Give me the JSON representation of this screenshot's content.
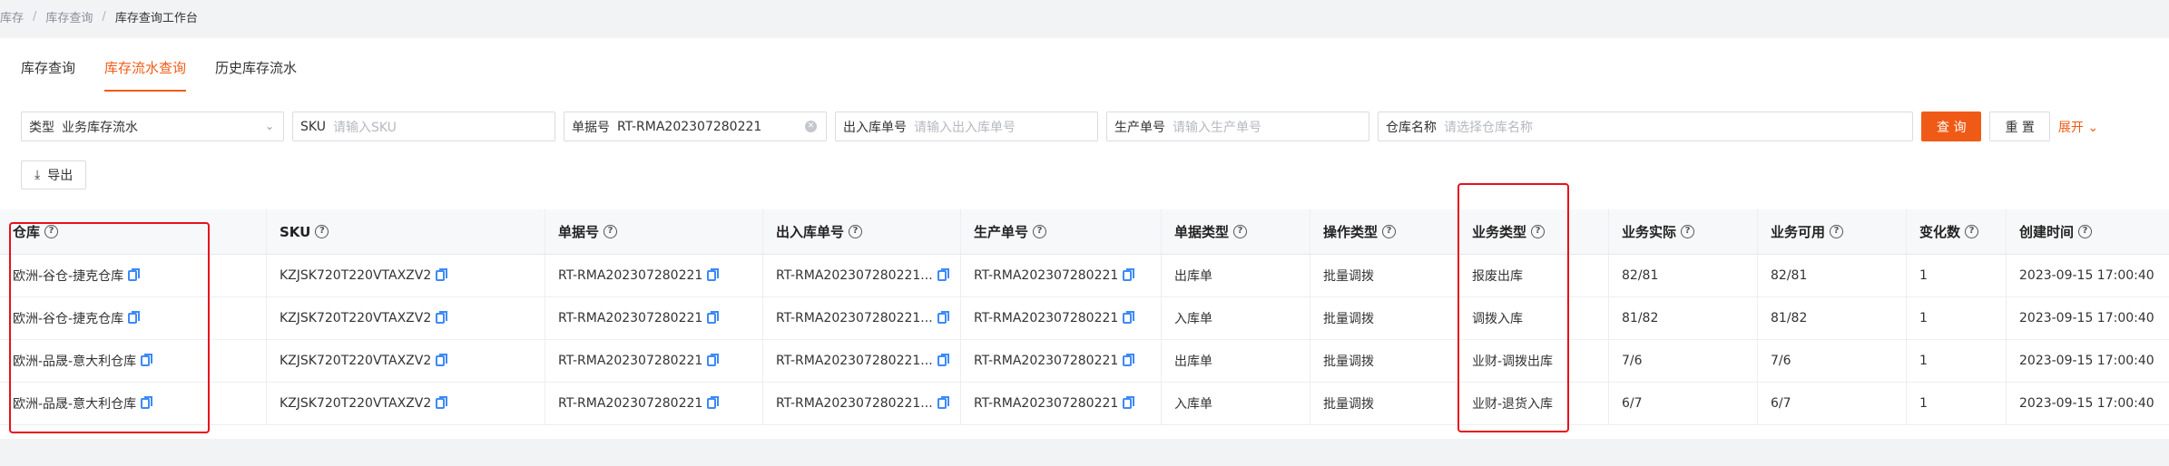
{
  "breadcrumb": [
    "库存",
    "库存查询",
    "库存查询工作台"
  ],
  "tabs": [
    {
      "label": "库存查询",
      "active": false
    },
    {
      "label": "库存流水查询",
      "active": true
    },
    {
      "label": "历史库存流水",
      "active": false
    }
  ],
  "filters": {
    "type": {
      "label": "类型",
      "value": "业务库存流水"
    },
    "sku": {
      "label": "SKU",
      "placeholder": "请输入SKU"
    },
    "doc_no": {
      "label": "单据号",
      "value": "RT-RMA202307280221"
    },
    "io_no": {
      "label": "出入库单号",
      "placeholder": "请输入出入库单号"
    },
    "prod_no": {
      "label": "生产单号",
      "placeholder": "请输入生产单号"
    },
    "warehouse": {
      "label": "仓库名称",
      "placeholder": "请选择仓库名称"
    },
    "query_label": "查 询",
    "reset_label": "重 置",
    "expand_label": "展开"
  },
  "export_label": "导出",
  "table": {
    "columns": [
      "仓库",
      "SKU",
      "单据号",
      "出入库单号",
      "生产单号",
      "单据类型",
      "操作类型",
      "业务类型",
      "业务实际",
      "业务可用",
      "变化数",
      "创建时间"
    ],
    "rows": [
      [
        "欧洲-谷仓-捷克仓库",
        "KZJSK720T220VTAXZV2",
        "RT-RMA202307280221",
        "RT-RMA202307280221...",
        "RT-RMA202307280221",
        "出库单",
        "批量调拨",
        "报废出库",
        "82/81",
        "82/81",
        "1",
        "2023-09-15 17:00:40"
      ],
      [
        "欧洲-谷仓-捷克仓库",
        "KZJSK720T220VTAXZV2",
        "RT-RMA202307280221",
        "RT-RMA202307280221...",
        "RT-RMA202307280221",
        "入库单",
        "批量调拨",
        "调拨入库",
        "81/82",
        "81/82",
        "1",
        "2023-09-15 17:00:40"
      ],
      [
        "欧洲-品晟-意大利仓库",
        "KZJSK720T220VTAXZV2",
        "RT-RMA202307280221",
        "RT-RMA202307280221...",
        "RT-RMA202307280221",
        "出库单",
        "批量调拨",
        "业财-调拨出库",
        "7/6",
        "7/6",
        "1",
        "2023-09-15 17:00:40"
      ],
      [
        "欧洲-品晟-意大利仓库",
        "KZJSK720T220VTAXZV2",
        "RT-RMA202307280221",
        "RT-RMA202307280221...",
        "RT-RMA202307280221",
        "入库单",
        "批量调拨",
        "业财-退货入库",
        "6/7",
        "6/7",
        "1",
        "2023-09-15 17:00:40"
      ]
    ]
  },
  "colors": {
    "accent": "#ef5b16",
    "highlight": "#e8101c",
    "copy_icon": "#3d8af7"
  }
}
